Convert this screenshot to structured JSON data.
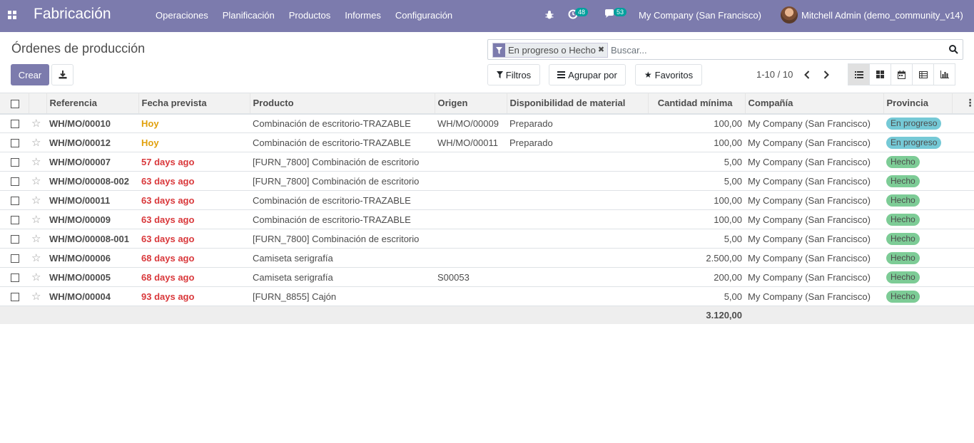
{
  "navbar": {
    "app_title": "Fabricación",
    "menu": [
      "Operaciones",
      "Planificación",
      "Productos",
      "Informes",
      "Configuración"
    ],
    "activity_count": "48",
    "message_count": "53",
    "company": "My Company (San Francisco)",
    "user": "Mitchell Admin (demo_community_v14)",
    "accent_color": "#7c7bad"
  },
  "control_panel": {
    "breadcrumb": "Órdenes de producción",
    "create_label": "Crear",
    "download_icon": "download-icon",
    "facet_label": "En progreso o Hecho",
    "search_placeholder": "Buscar...",
    "filters_label": "Filtros",
    "groupby_label": "Agrupar por",
    "favorites_label": "Favoritos",
    "pager": "1-10 / 10"
  },
  "table": {
    "headers": {
      "reference": "Referencia",
      "date": "Fecha prevista",
      "product": "Producto",
      "origin": "Origen",
      "availability": "Disponibilidad de material",
      "qty": "Cantidad mínima",
      "company": "Compañía",
      "state": "Provincia"
    },
    "rows": [
      {
        "ref": "WH/MO/00010",
        "date": "Hoy",
        "date_type": "today",
        "product": "Combinación de escritorio-TRAZABLE",
        "origin": "WH/MO/00009",
        "availability": "Preparado",
        "qty": "100,00",
        "company": "My Company (San Francisco)",
        "state": "En progreso",
        "state_type": "progress"
      },
      {
        "ref": "WH/MO/00012",
        "date": "Hoy",
        "date_type": "today",
        "product": "Combinación de escritorio-TRAZABLE",
        "origin": "WH/MO/00011",
        "availability": "Preparado",
        "qty": "100,00",
        "company": "My Company (San Francisco)",
        "state": "En progreso",
        "state_type": "progress"
      },
      {
        "ref": "WH/MO/00007",
        "date": "57 days ago",
        "date_type": "late",
        "product": "[FURN_7800] Combinación de escritorio",
        "origin": "",
        "availability": "",
        "qty": "5,00",
        "company": "My Company (San Francisco)",
        "state": "Hecho",
        "state_type": "done"
      },
      {
        "ref": "WH/MO/00008-002",
        "date": "63 days ago",
        "date_type": "late",
        "product": "[FURN_7800] Combinación de escritorio",
        "origin": "",
        "availability": "",
        "qty": "5,00",
        "company": "My Company (San Francisco)",
        "state": "Hecho",
        "state_type": "done"
      },
      {
        "ref": "WH/MO/00011",
        "date": "63 days ago",
        "date_type": "late",
        "product": "Combinación de escritorio-TRAZABLE",
        "origin": "",
        "availability": "",
        "qty": "100,00",
        "company": "My Company (San Francisco)",
        "state": "Hecho",
        "state_type": "done"
      },
      {
        "ref": "WH/MO/00009",
        "date": "63 days ago",
        "date_type": "late",
        "product": "Combinación de escritorio-TRAZABLE",
        "origin": "",
        "availability": "",
        "qty": "100,00",
        "company": "My Company (San Francisco)",
        "state": "Hecho",
        "state_type": "done"
      },
      {
        "ref": "WH/MO/00008-001",
        "date": "63 days ago",
        "date_type": "late",
        "product": "[FURN_7800] Combinación de escritorio",
        "origin": "",
        "availability": "",
        "qty": "5,00",
        "company": "My Company (San Francisco)",
        "state": "Hecho",
        "state_type": "done"
      },
      {
        "ref": "WH/MO/00006",
        "date": "68 days ago",
        "date_type": "late",
        "product": "Camiseta serigrafía",
        "origin": "",
        "availability": "",
        "qty": "2.500,00",
        "company": "My Company (San Francisco)",
        "state": "Hecho",
        "state_type": "done"
      },
      {
        "ref": "WH/MO/00005",
        "date": "68 days ago",
        "date_type": "late",
        "product": "Camiseta serigrafía",
        "origin": "S00053",
        "availability": "",
        "qty": "200,00",
        "company": "My Company (San Francisco)",
        "state": "Hecho",
        "state_type": "done"
      },
      {
        "ref": "WH/MO/00004",
        "date": "93 days ago",
        "date_type": "late",
        "product": "[FURN_8855] Cajón",
        "origin": "",
        "availability": "",
        "qty": "5,00",
        "company": "My Company (San Francisco)",
        "state": "Hecho",
        "state_type": "done"
      }
    ],
    "total_qty": "3.120,00",
    "colors": {
      "today": "#e1a00b",
      "late": "#d9383b",
      "progress": "#75c9d6",
      "done": "#7dcc96"
    }
  }
}
